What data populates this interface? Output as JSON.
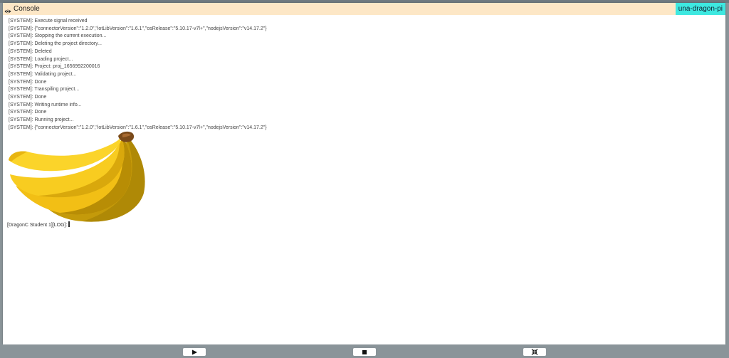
{
  "console": {
    "title": "Console",
    "device": "una-dragon-pi",
    "log_lines": [
      "[SYSTEM]: Execute signal received",
      "[SYSTEM]: {\"connectorVersion\":\"1.2.0\",\"iotLibVersion\":\"1.6.1\",\"osRelease\":\"5.10.17-v7l+\",\"nodejsVersion\":\"v14.17.2\"}",
      "[SYSTEM]: Stopping the current execution...",
      "[SYSTEM]: Deleting the project directory...",
      "[SYSTEM]: Deleted",
      "[SYSTEM]: Loading project...",
      "[SYSTEM]: Project: proj_1656992200016",
      "[SYSTEM]: Validating project...",
      "[SYSTEM]: Done",
      "[SYSTEM]: Transpiling project...",
      "[SYSTEM]: Done",
      "[SYSTEM]: Writing runtime info...",
      "[SYSTEM]: Done",
      "[SYSTEM]: Running project...",
      "[SYSTEM]: {\"connectorVersion\":\"1.2.0\",\"iotLibVersion\":\"1.6.1\",\"osRelease\":\"5.10.17-v7l+\",\"nodejsVersion\":\"v14.17.2\"}"
    ],
    "prompt": "[DragonC Student 1][LOG]:"
  },
  "controls": {
    "play_icon": "play-icon",
    "stop_icon": "stop-icon",
    "collapse_icon": "collapse-arrows-icon"
  },
  "colors": {
    "header_bg": "#fde7c6",
    "device_badge_bg": "#3ee8e0",
    "chrome_bg": "#8a9499",
    "banana_yellow": "#f5c518"
  }
}
